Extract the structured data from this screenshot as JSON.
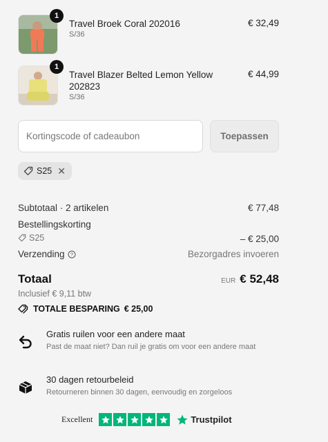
{
  "cart": {
    "items": [
      {
        "quantity": "1",
        "name": "Travel Broek Coral 202016",
        "variant": "S/36",
        "price": "€ 32,49"
      },
      {
        "quantity": "1",
        "name": "Travel Blazer Belted Lemon Yellow 202823",
        "variant": "S/36",
        "price": "€ 44,99"
      }
    ]
  },
  "discount": {
    "placeholder": "Kortingscode of cadeaubon",
    "apply_label": "Toepassen",
    "applied_code": "S25"
  },
  "summary": {
    "subtotal_label": "Subtotaal · 2 artikelen",
    "subtotal_value": "€ 77,48",
    "order_discount_label": "Bestellingskorting",
    "discount_code": "S25",
    "discount_value": "– € 25,00",
    "shipping_label": "Verzending",
    "shipping_value": "Bezorgadres invoeren",
    "total_label": "Totaal",
    "currency": "EUR",
    "total_value": "€ 52,48",
    "tax_note": "Inclusief € 9,11 btw",
    "savings_label": "TOTALE BESPARING",
    "savings_value": "€ 25,00"
  },
  "perks": [
    {
      "icon": "exchange-icon",
      "title": "Gratis ruilen voor een andere maat",
      "description": "Past de maat niet? Dan ruil je gratis om voor een andere maat"
    },
    {
      "icon": "box-icon",
      "title": "30 dagen retourbeleid",
      "description": "Retourneren binnen 30 dagen, eenvoudig en zorgeloos"
    }
  ],
  "trustpilot": {
    "rating_text": "Excellent",
    "brand": "Trustpilot",
    "stars": 5,
    "star_color": "#00b67a"
  },
  "colors": {
    "background": "#f4f4f4",
    "text": "#1a1a1a",
    "muted": "#777777",
    "badge": "#111111"
  }
}
